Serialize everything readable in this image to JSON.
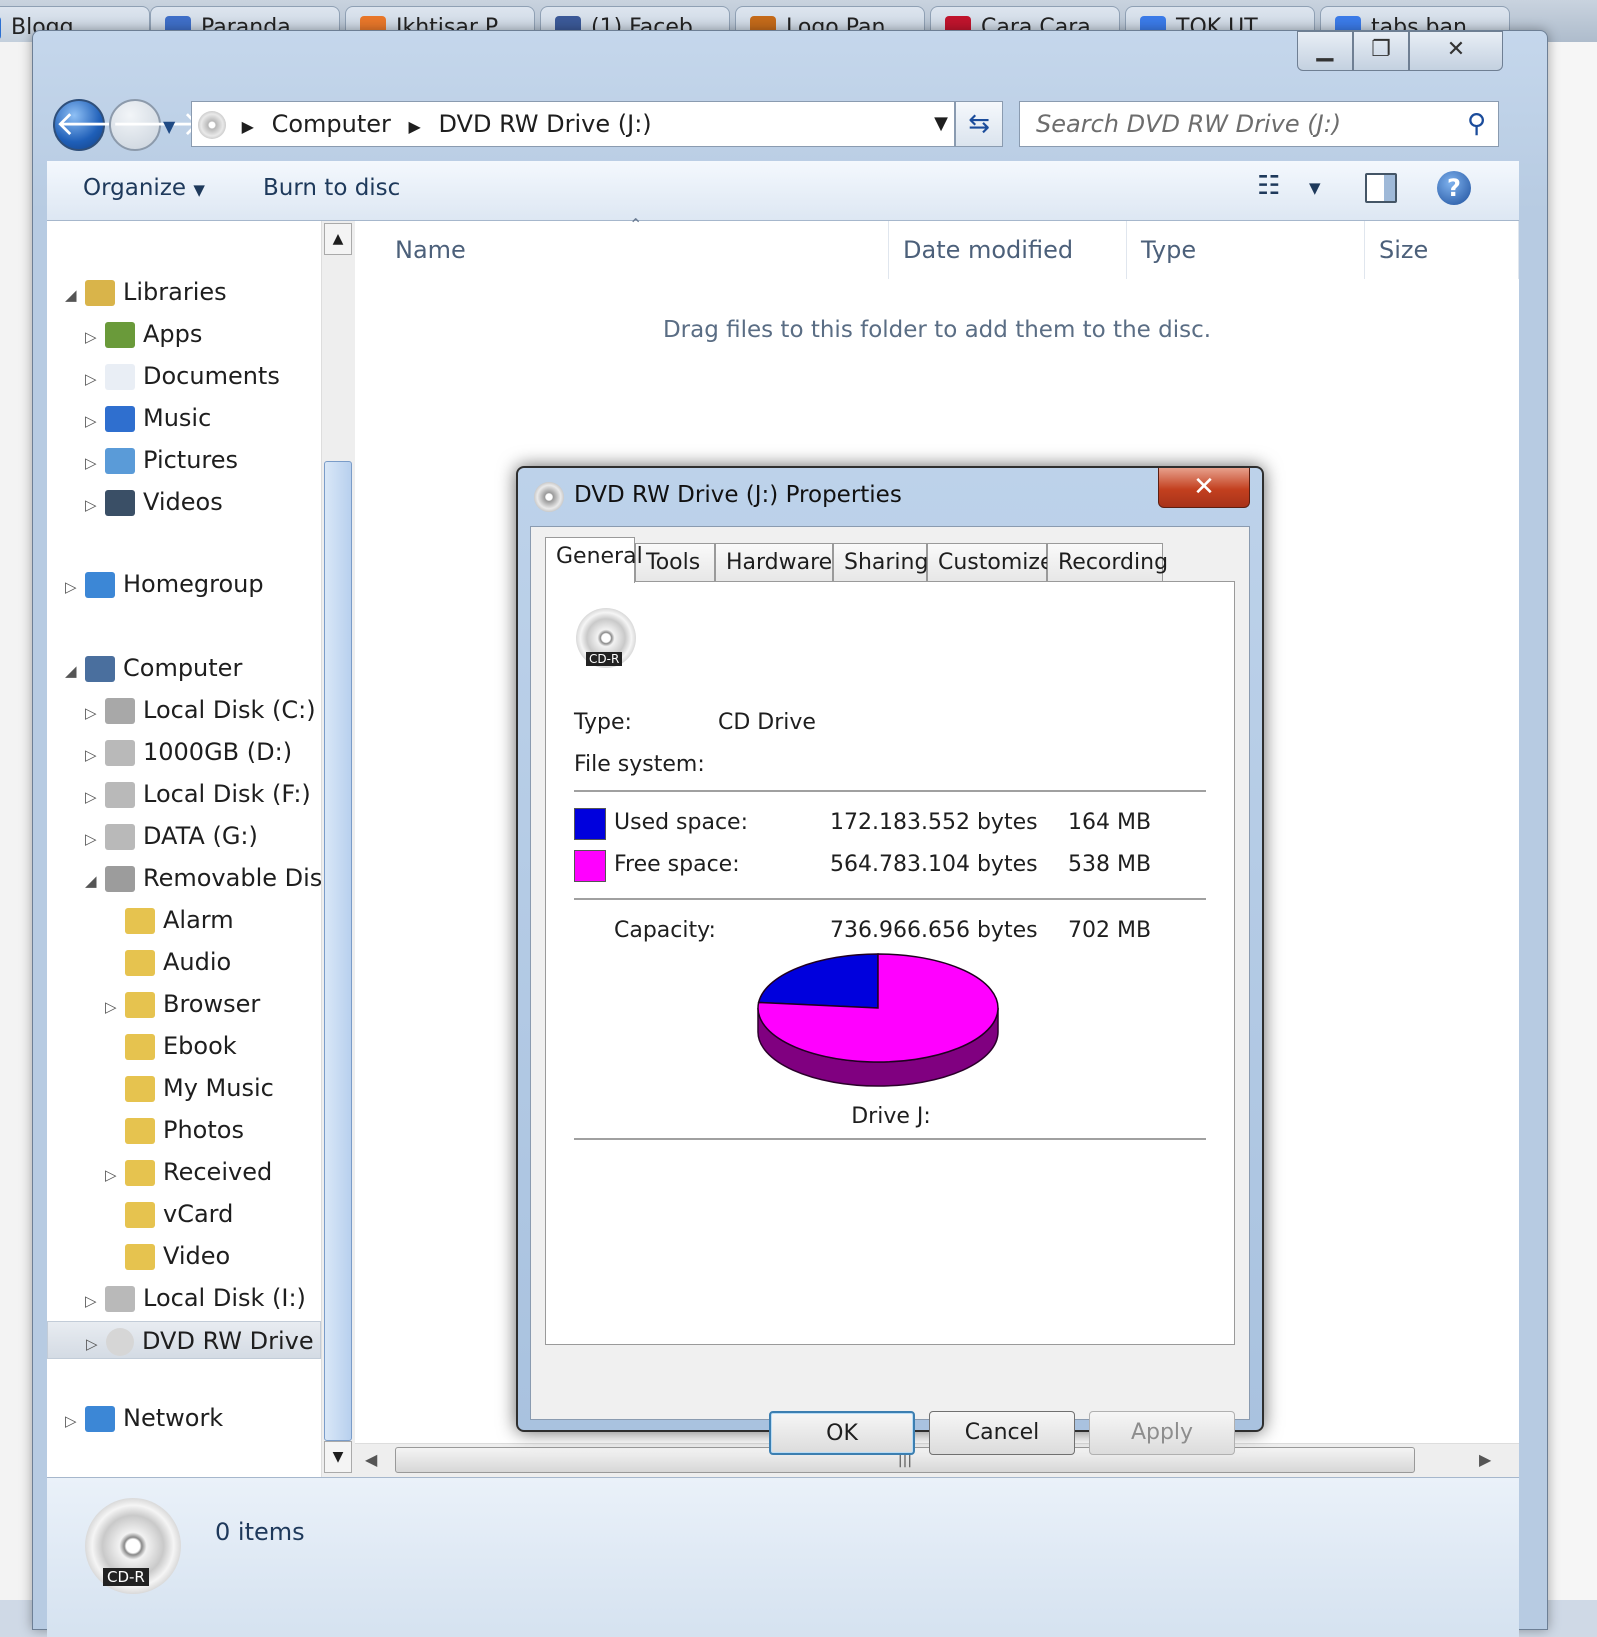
{
  "browser_tabs": [
    "Blogg",
    "Paranda",
    "Ikhtisar P",
    "(1) Faceb",
    "Logo Pan",
    "Cara Cara",
    "TOK UT",
    "tabs ban"
  ],
  "explorer": {
    "address": {
      "segments": [
        "Computer",
        "DVD RW Drive (J:)"
      ]
    },
    "search_placeholder": "Search DVD RW Drive (J:)",
    "toolbar": {
      "organize": "Organize",
      "burn": "Burn to disc"
    },
    "columns": [
      "Name",
      "Date modified",
      "Type",
      "Size"
    ],
    "empty_message": "Drag files to this folder to add them to the disc.",
    "status": "0 items",
    "status_icon_label": "CD-R",
    "tree": [
      {
        "label": "Libraries",
        "level": 0,
        "expander": "expanded",
        "icon": "libraries-icon"
      },
      {
        "label": "Apps",
        "level": 1,
        "expander": "collapsed",
        "icon": "apps-icon"
      },
      {
        "label": "Documents",
        "level": 1,
        "expander": "collapsed",
        "icon": "documents-icon"
      },
      {
        "label": "Music",
        "level": 1,
        "expander": "collapsed",
        "icon": "music-icon"
      },
      {
        "label": "Pictures",
        "level": 1,
        "expander": "collapsed",
        "icon": "pictures-icon"
      },
      {
        "label": "Videos",
        "level": 1,
        "expander": "collapsed",
        "icon": "videos-icon"
      },
      {
        "label": "Homegroup",
        "level": 0,
        "expander": "collapsed",
        "icon": "homegroup-icon"
      },
      {
        "label": "Computer",
        "level": 0,
        "expander": "expanded",
        "icon": "computer-icon"
      },
      {
        "label": "Local Disk (C:)",
        "level": 1,
        "expander": "collapsed",
        "icon": "system-drive-icon"
      },
      {
        "label": "1000GB (D:)",
        "level": 1,
        "expander": "collapsed",
        "icon": "drive-icon"
      },
      {
        "label": "Local Disk (F:)",
        "level": 1,
        "expander": "collapsed",
        "icon": "drive-icon"
      },
      {
        "label": "DATA (G:)",
        "level": 1,
        "expander": "collapsed",
        "icon": "drive-icon"
      },
      {
        "label": "Removable Disk",
        "level": 1,
        "expander": "expanded",
        "icon": "removable-drive-icon"
      },
      {
        "label": "Alarm",
        "level": 2,
        "expander": "none",
        "icon": "folder-icon"
      },
      {
        "label": "Audio",
        "level": 2,
        "expander": "none",
        "icon": "folder-icon"
      },
      {
        "label": "Browser",
        "level": 2,
        "expander": "collapsed",
        "icon": "folder-icon"
      },
      {
        "label": "Ebook",
        "level": 2,
        "expander": "none",
        "icon": "folder-icon"
      },
      {
        "label": "My Music",
        "level": 2,
        "expander": "none",
        "icon": "folder-icon"
      },
      {
        "label": "Photos",
        "level": 2,
        "expander": "none",
        "icon": "folder-icon"
      },
      {
        "label": "Received",
        "level": 2,
        "expander": "collapsed",
        "icon": "folder-icon"
      },
      {
        "label": "vCard",
        "level": 2,
        "expander": "none",
        "icon": "folder-icon"
      },
      {
        "label": "Video",
        "level": 2,
        "expander": "none",
        "icon": "folder-icon"
      },
      {
        "label": "Local Disk (I:)",
        "level": 1,
        "expander": "collapsed",
        "icon": "drive-icon"
      },
      {
        "label": "DVD RW Drive (J:)",
        "level": 1,
        "expander": "collapsed",
        "icon": "dvd-drive-icon",
        "selected": true
      },
      {
        "label": "Network",
        "level": 0,
        "expander": "collapsed",
        "icon": "network-icon"
      }
    ]
  },
  "dialog": {
    "title": "DVD RW Drive (J:) Properties",
    "tabs": [
      "General",
      "Tools",
      "Hardware",
      "Sharing",
      "Customize",
      "Recording"
    ],
    "active_tab": "General",
    "drive_icon_label": "CD-R",
    "type_label": "Type:",
    "type_value": "CD Drive",
    "fs_label": "File system:",
    "used": {
      "label": "Used space:",
      "bytes": "172.183.552 bytes",
      "size": "164 MB",
      "color": "#0000dd"
    },
    "free": {
      "label": "Free space:",
      "bytes": "564.783.104 bytes",
      "size": "538 MB",
      "color": "#ff00ff"
    },
    "capacity": {
      "label": "Capacity:",
      "bytes": "736.966.656 bytes",
      "size": "702 MB"
    },
    "drive_caption": "Drive J:",
    "buttons": {
      "ok": "OK",
      "cancel": "Cancel",
      "apply": "Apply"
    }
  },
  "chart_data": {
    "type": "pie",
    "categories": [
      "Used space",
      "Free space"
    ],
    "values": [
      164,
      538
    ],
    "colors": [
      "#0000dd",
      "#ff00ff"
    ]
  }
}
